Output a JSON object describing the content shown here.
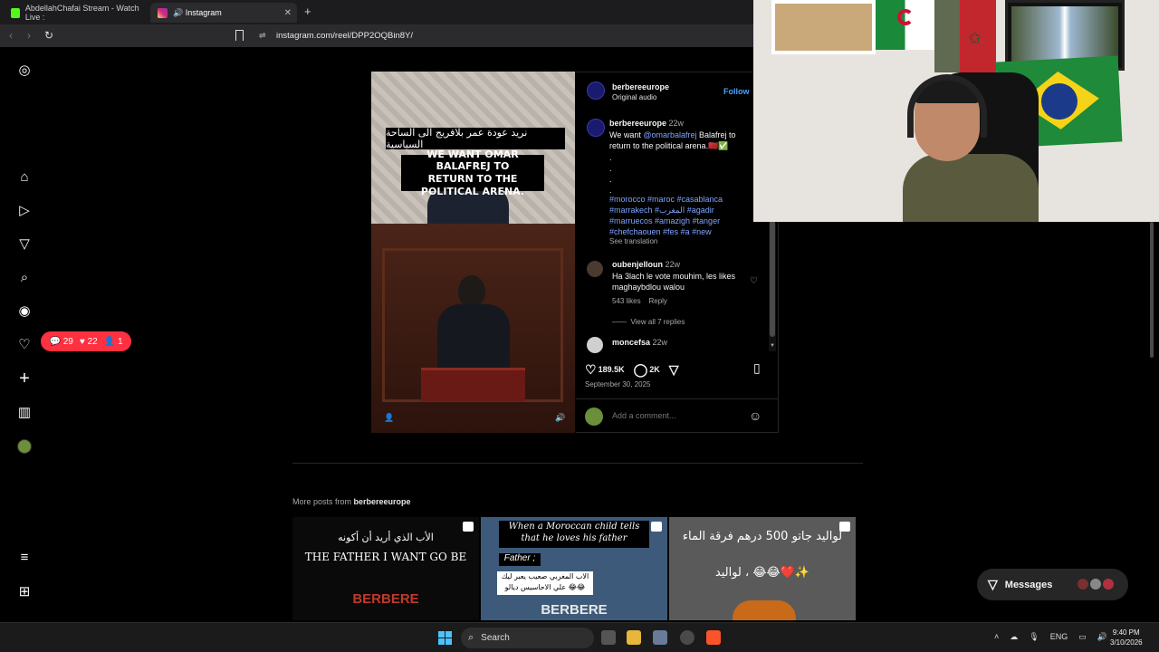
{
  "browser": {
    "tabs": [
      {
        "label": "AbdellahChafai Stream - Watch Live :"
      },
      {
        "label": "🔊 Instagram"
      }
    ],
    "new_tab": "+",
    "url": "instagram.com/reel/DPP2OQBin8Y/"
  },
  "sidebar": {
    "notifications": {
      "comments": "29",
      "likes": "22",
      "follows": "1"
    }
  },
  "video": {
    "caption_ar": "نريد عودة عمر بلافريج الى الساحة السياسية",
    "caption_en_line1": "WE WANT OMAR BALAFREJ TO",
    "caption_en_line2": "RETURN TO THE POLITICAL ARENA."
  },
  "post": {
    "username": "berbereeurope",
    "audio": "Original audio",
    "follow": "Follow",
    "caption_user": "berbereeurope",
    "caption_time": "22w",
    "caption_text_pre": "We want ",
    "caption_mention": "@omarbalafrej",
    "caption_text_post": " Balafrej to return to the political arena.🇲🇦✅",
    "caption_dots": ".\n.\n.\n.",
    "hashtags": "#morocco #maroc #casablanca #marrakech #المغرب #agadir #marruecos #amazigh #tanger #chefchaouen #fes #a #new",
    "see_translation": "See translation",
    "comments": [
      {
        "user": "oubenjelloun",
        "time": "22w",
        "text": "Ha 3lach le vote mouhim, les likes maghaybdlou walou",
        "likes": "543 likes",
        "reply": "Reply",
        "view_replies": "View all 7 replies"
      },
      {
        "user": "moncefsa",
        "time": "22w"
      }
    ],
    "like_count": "189.5K",
    "comment_count": "2K",
    "date": "September 30, 2025",
    "add_comment_placeholder": "Add a comment..."
  },
  "more_posts": {
    "prefix": "More posts from ",
    "username": "berbereeurope",
    "thumbs": [
      {
        "ar": "الأب الذي أريد أن أكونه",
        "en": "THE FATHER I WANT GO BE",
        "logo": "BERBERE"
      },
      {
        "title": "When a Moroccan child tells that he loves his father",
        "tag": "Father ;",
        "ar": "الاب المغربي صعيب يعبر ليك علي الاحاسيس ديالو 😂😂",
        "logo": "BERBERE"
      },
      {
        "ar1": "لواليد جاتو 500 درهم فرقة الماء",
        "ar2": "لواليد ، 😂😂❤️✨"
      }
    ]
  },
  "messages": {
    "label": "Messages"
  },
  "taskbar": {
    "search": "Search",
    "lang": "ENG",
    "time": "9:40 PM",
    "date": "3/10/2026"
  },
  "colors": {
    "notification_red": "#ff3040",
    "link_blue": "#7ea4ff",
    "follow_blue": "#4aa3ff",
    "background": "#000000"
  }
}
